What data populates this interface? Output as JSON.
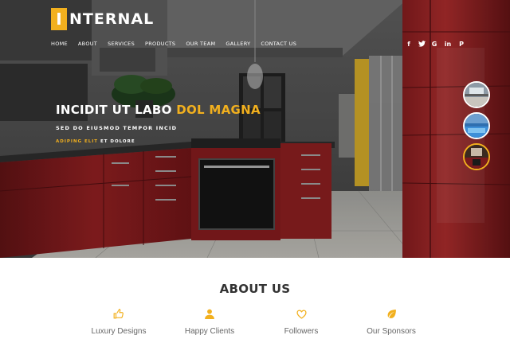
{
  "brand": {
    "initial": "I",
    "rest": "NTERNAL"
  },
  "nav": [
    "HOME",
    "ABOUT",
    "SERVICES",
    "PRODUCTS",
    "OUR TEAM",
    "GALLERY",
    "CONTACT US"
  ],
  "social": [
    {
      "icon": "facebook-icon",
      "glyph": "f"
    },
    {
      "icon": "twitter-icon",
      "glyph": "t"
    },
    {
      "icon": "google-icon",
      "glyph": "G"
    },
    {
      "icon": "linkedin-icon",
      "glyph": "in"
    },
    {
      "icon": "pinterest-icon",
      "glyph": "P"
    }
  ],
  "hero": {
    "title_main": "INCIDIT UT LABO ",
    "title_highlight": "DOL MAGNA",
    "subtitle": "SED DO EIUSMOD TEMPOR INCID",
    "small_highlight": "ADIPING ELIT",
    "small_rest": " ET DOLORE"
  },
  "about": {
    "title": "ABOUT US",
    "features": [
      {
        "icon": "thumbs-up-icon",
        "label": "Luxury Designs"
      },
      {
        "icon": "user-icon",
        "label": "Happy Clients"
      },
      {
        "icon": "heart-icon",
        "label": "Followers"
      },
      {
        "icon": "leaf-icon",
        "label": "Our Sponsors"
      }
    ]
  },
  "colors": {
    "accent": "#f2b01e",
    "cabinet_red": "#7a1a1c",
    "text_dark": "#333333",
    "text_gray": "#666666"
  }
}
